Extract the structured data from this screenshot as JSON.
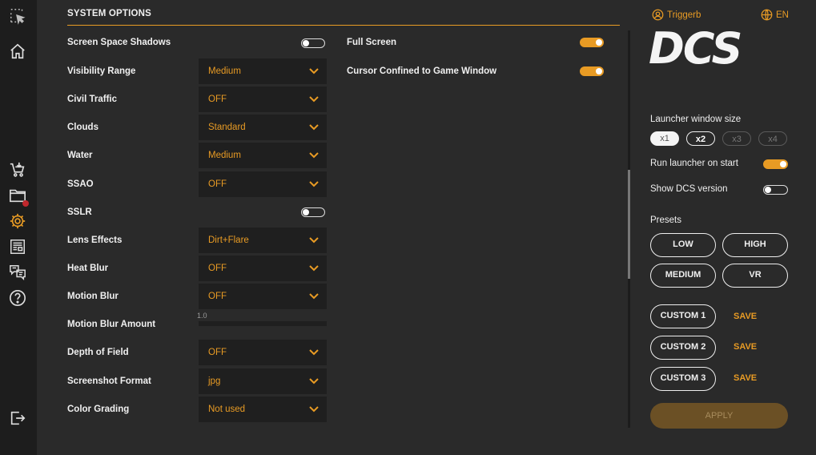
{
  "sidebar": {
    "icons": [
      "selection-icon",
      "home-icon",
      "cart-download-icon",
      "folder-icon",
      "settings-icon",
      "news-icon",
      "chat-icon",
      "help-icon",
      "logout-icon"
    ]
  },
  "section": {
    "title": "SYSTEM OPTIONS"
  },
  "left_options": [
    {
      "label": "Screen Space Shadows",
      "type": "toggle",
      "state": "off"
    },
    {
      "label": "Visibility Range",
      "type": "select",
      "value": "Medium"
    },
    {
      "label": "Civil Traffic",
      "type": "select",
      "value": "OFF"
    },
    {
      "label": "Clouds",
      "type": "select",
      "value": "Standard"
    },
    {
      "label": "Water",
      "type": "select",
      "value": "Medium"
    },
    {
      "label": "SSAO",
      "type": "select",
      "value": "OFF"
    },
    {
      "label": "SSLR",
      "type": "toggle",
      "state": "off"
    },
    {
      "label": "Lens Effects",
      "type": "select",
      "value": "Dirt+Flare"
    },
    {
      "label": "Heat Blur",
      "type": "select",
      "value": "OFF"
    },
    {
      "label": "Motion Blur",
      "type": "select",
      "value": "OFF"
    },
    {
      "label": "Motion Blur Amount",
      "type": "slider",
      "value": "1.0"
    },
    {
      "label": "Depth of Field",
      "type": "select",
      "value": "OFF"
    },
    {
      "label": "Screenshot Format",
      "type": "select",
      "value": "jpg"
    },
    {
      "label": "Color Grading",
      "type": "select",
      "value": "Not used"
    }
  ],
  "right_options": [
    {
      "label": "Full Screen",
      "state": "on"
    },
    {
      "label": "Cursor Confined to Game Window",
      "state": "on"
    }
  ],
  "account": {
    "user": "Triggerb",
    "language": "EN"
  },
  "logo_text": "DCS",
  "launcher": {
    "size_label": "Launcher window size",
    "sizes": [
      "x1",
      "x2",
      "x3",
      "x4"
    ],
    "run_on_start_label": "Run launcher on start",
    "run_on_start": "on",
    "show_version_label": "Show DCS version",
    "show_version": "off"
  },
  "presets": {
    "label": "Presets",
    "buttons": [
      "LOW",
      "HIGH",
      "MEDIUM",
      "VR"
    ],
    "custom": [
      "CUSTOM 1",
      "CUSTOM 2",
      "CUSTOM 3"
    ],
    "save_label": "SAVE"
  },
  "apply_label": "APPLY",
  "colors": {
    "accent": "#e89b24",
    "background": "#2a2a2a",
    "sidebar": "#1d1d1d",
    "field": "#1f1f1f"
  }
}
